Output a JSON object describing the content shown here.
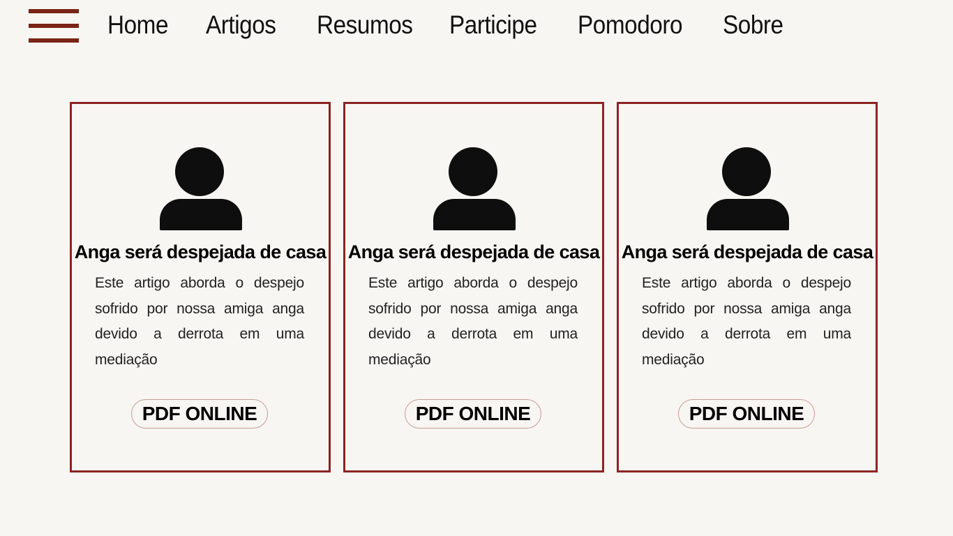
{
  "nav": {
    "menu_icon": "hamburger-menu-icon",
    "links": [
      "Home",
      "Artigos",
      "Resumos",
      "Participe",
      "Pomodoro",
      "Sobre"
    ]
  },
  "colors": {
    "background": "#f8f6f2",
    "accent": "#7a2416",
    "card_border": "#8b2424",
    "icon": "#0e0e0e"
  },
  "cards": [
    {
      "icon": "user-avatar-icon",
      "title": "Anga será despejada de casa",
      "description": "Este artigo aborda o despejo sofrido por nossa amiga anga devido a derrota em uma mediação",
      "button_label": "PDF ONLINE"
    },
    {
      "icon": "user-avatar-icon",
      "title": "Anga será despejada de casa",
      "description": "Este artigo aborda o despejo sofrido por nossa amiga anga devido a derrota em uma mediação",
      "button_label": "PDF ONLINE"
    },
    {
      "icon": "user-avatar-icon",
      "title": "Anga será despejada de casa",
      "description": "Este artigo aborda o despejo sofrido por nossa amiga anga devido a derrota em uma mediação",
      "button_label": "PDF ONLINE"
    }
  ]
}
